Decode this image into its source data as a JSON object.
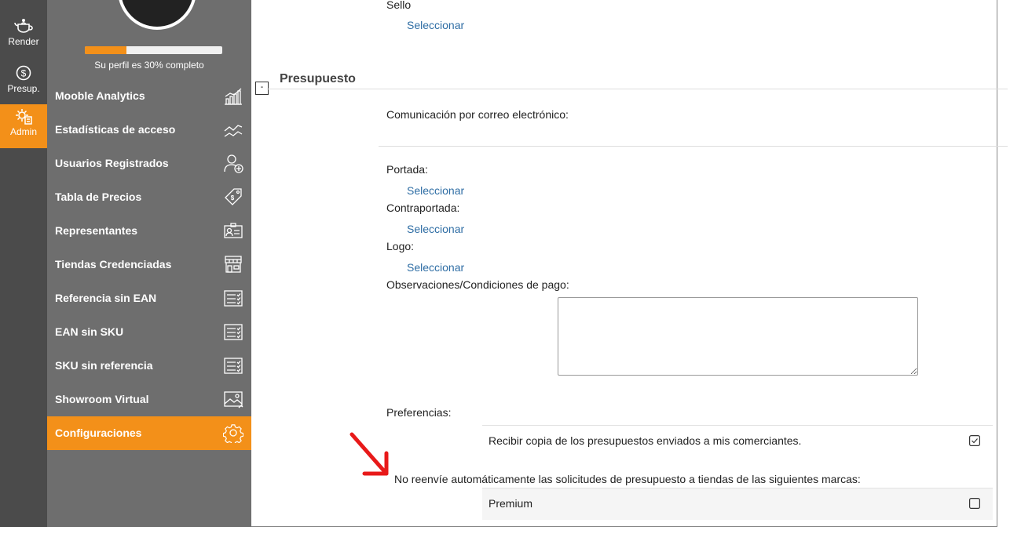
{
  "rail": {
    "items": [
      {
        "label": "Render",
        "icon": "teapot-icon"
      },
      {
        "label": "Presup.",
        "icon": "dollar-icon"
      },
      {
        "label": "Admin",
        "icon": "settings-doc-icon"
      }
    ],
    "active": "Admin"
  },
  "profile": {
    "progress_text": "Su perfil es 30% completo",
    "progress_fraction": 0.3
  },
  "sidebar": {
    "items": [
      {
        "label": "Mooble Analytics",
        "icon": "analytics-chart-icon"
      },
      {
        "label": "Estadísticas de acceso",
        "icon": "trend-lines-icon"
      },
      {
        "label": "Usuarios Registrados",
        "icon": "add-user-icon"
      },
      {
        "label": "Tabla de Precios",
        "icon": "price-tag-icon"
      },
      {
        "label": "Representantes",
        "icon": "id-card-icon"
      },
      {
        "label": "Tiendas Credenciadas",
        "icon": "storefront-icon"
      },
      {
        "label": "Referencia sin EAN",
        "icon": "checklist-icon"
      },
      {
        "label": "EAN sin SKU",
        "icon": "checklist-icon"
      },
      {
        "label": "SKU sin referencia",
        "icon": "checklist-icon"
      },
      {
        "label": "Showroom Virtual",
        "icon": "image-gallery-icon"
      },
      {
        "label": "Configuraciones",
        "icon": "gear-icon"
      }
    ],
    "active": "Configuraciones"
  },
  "main": {
    "sello_label": "Sello",
    "select_link": "Seleccionar",
    "section_title": "Presupuesto",
    "collapse_symbol": "-",
    "email_label": "Comunicación por correo electrónico:",
    "portada_label": "Portada:",
    "contraportada_label": "Contraportada:",
    "logo_label": "Logo:",
    "observaciones_label": "Observaciones/Condiciones de pago:",
    "observaciones_value": "",
    "preferencias_label": "Preferencias:",
    "pref_copy_label": "Recibir copia de los presupuestos enviados a mis comerciantes.",
    "pref_copy_checked": true,
    "no_forward_label": "No reenvíe automáticamente las solicitudes de presupuesto a tiendas de las siguientes marcas:",
    "brands": [
      {
        "label": "Premium",
        "checked": false
      }
    ]
  },
  "colors": {
    "accent": "#f39019",
    "rail_bg": "#4b4b4b",
    "sidebar_bg": "#6e6e6e",
    "link": "#2e6da4",
    "annotation_arrow": "#e81919"
  }
}
